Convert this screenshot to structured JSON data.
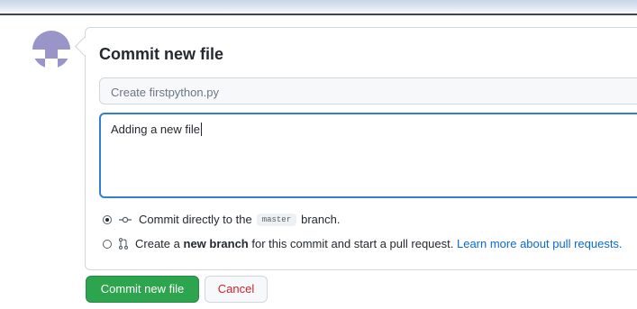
{
  "form": {
    "title": "Commit new file",
    "summary_placeholder": "Create firstpython.py",
    "description_value": "Adding a new file"
  },
  "options": {
    "direct": {
      "prefix": "Commit directly to the",
      "branch": "master",
      "suffix": "branch.",
      "selected": true
    },
    "new_branch": {
      "prefix": "Create a",
      "bold": "new branch",
      "suffix": "for this commit and start a pull request.",
      "link": "Learn more about pull requests.",
      "selected": false
    }
  },
  "buttons": {
    "commit_label": "Commit new file",
    "cancel_label": "Cancel"
  },
  "colors": {
    "primary_button": "#2da44e",
    "cancel_text": "#cf222e",
    "link": "#0969da",
    "focus_border": "#2f7fd6",
    "avatar": "#9a95c9"
  }
}
